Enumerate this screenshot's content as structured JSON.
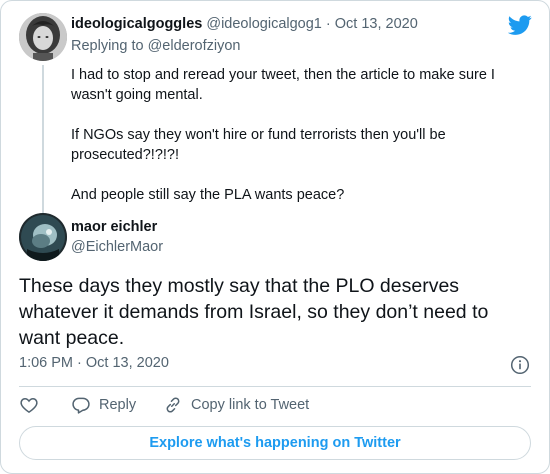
{
  "parent": {
    "name": "ideologicalgoggles",
    "handle": "@ideologicalgog1",
    "separator": "·",
    "date": "Oct 13, 2020",
    "replying_prefix": "Replying to ",
    "replying_to": "@elderofziyon",
    "paragraphs": [
      "I had to stop and reread your tweet, then the article to make sure I wasn't going mental.",
      "If NGOs say they won't hire or fund terrorists then you'll be prosecuted?!?!?!",
      "And people still say the PLA wants peace?"
    ]
  },
  "tweet": {
    "name": "maor eichler",
    "handle": "@EichlerMaor",
    "text": "These days they mostly say that the PLO deserves whatever it demands from Israel, so they don’t need to want peace.",
    "timestamp": "1:06 PM · Oct 13, 2020"
  },
  "actions": {
    "reply_label": "Reply",
    "copy_label": "Copy link to Tweet"
  },
  "footer": {
    "explore_label": "Explore what's happening on Twitter"
  },
  "icons": {
    "brand": "twitter-bird-icon",
    "info": "info-icon",
    "like": "heart-icon",
    "reply": "reply-bubble-icon",
    "copy": "link-icon"
  },
  "colors": {
    "twitter_blue": "#1d9bf0",
    "text_primary": "#0f1419",
    "text_secondary": "#536471",
    "border": "#cfd9de"
  }
}
